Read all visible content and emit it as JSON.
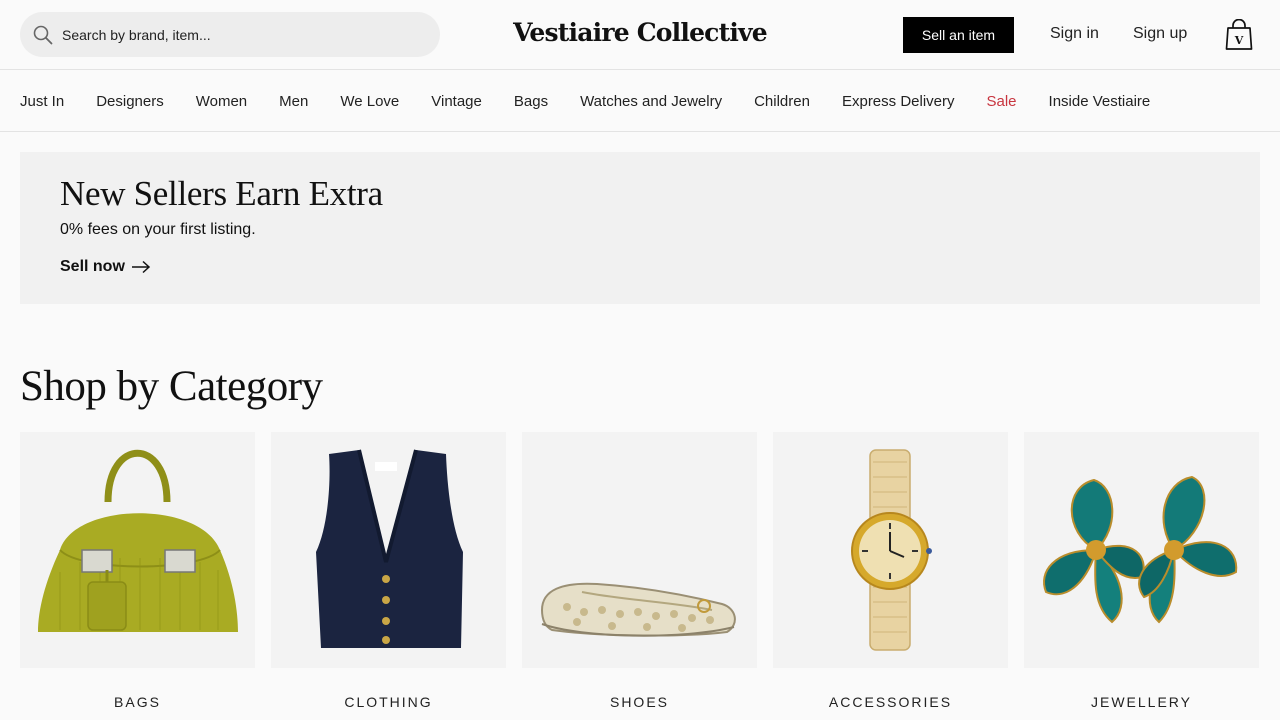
{
  "header": {
    "search_placeholder": "Search by brand, item...",
    "logo": "Vestiaire Collective",
    "sell_button": "Sell an item",
    "sign_in": "Sign in",
    "sign_up": "Sign up",
    "bag_letter": "V"
  },
  "nav": {
    "items": [
      "Just In",
      "Designers",
      "Women",
      "Men",
      "We Love",
      "Vintage",
      "Bags",
      "Watches and Jewelry",
      "Children",
      "Express Delivery",
      "Sale",
      "Inside Vestiaire"
    ]
  },
  "promo": {
    "title": "New Sellers Earn Extra",
    "subtitle": "0% fees on your first listing.",
    "cta": "Sell now"
  },
  "categories": {
    "title": "Shop by Category",
    "items": [
      {
        "label": "BAGS",
        "icon": "bag-image"
      },
      {
        "label": "CLOTHING",
        "icon": "vest-image"
      },
      {
        "label": "SHOES",
        "icon": "ballerina-shoe-image"
      },
      {
        "label": "ACCESSORIES",
        "icon": "watch-image"
      },
      {
        "label": "JEWELLERY",
        "icon": "earrings-image"
      }
    ]
  },
  "colors": {
    "sale": "#c8353f",
    "sell_button_bg": "#000000",
    "banner_bg": "#f1f1f1"
  }
}
